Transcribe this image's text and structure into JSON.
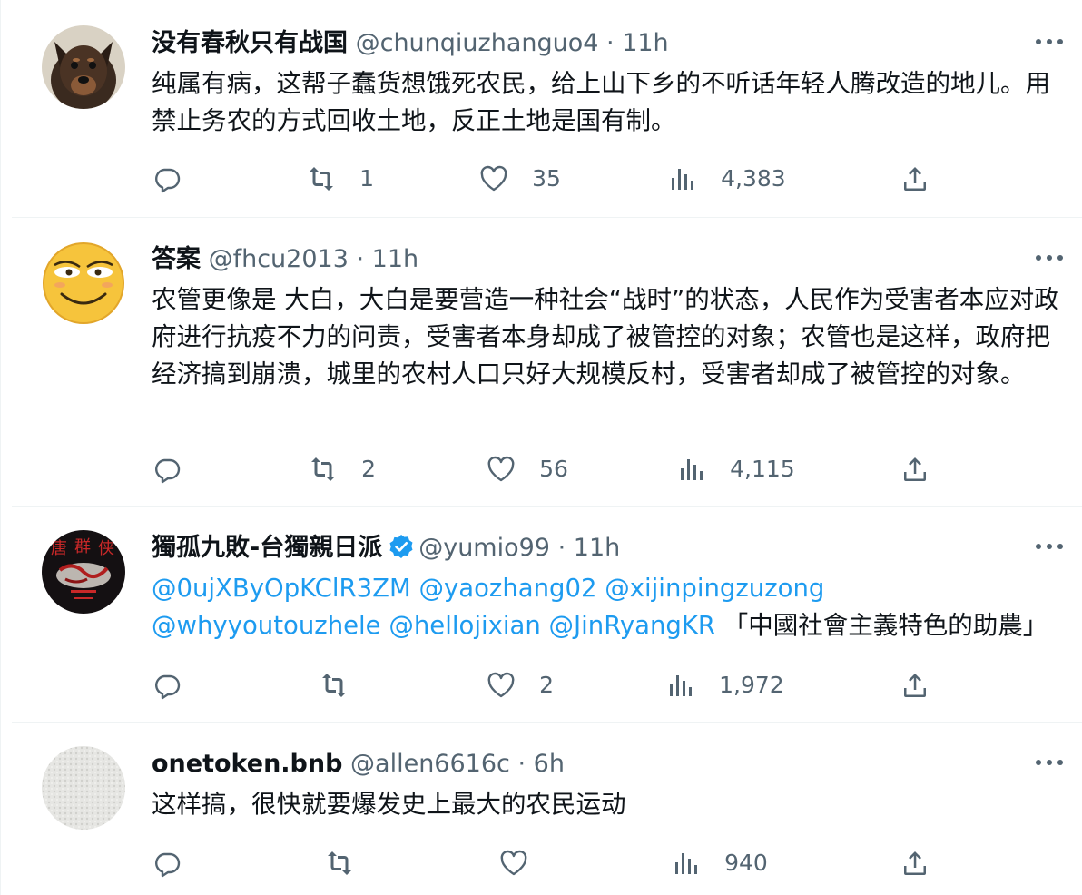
{
  "colors": {
    "text": "#0f1419",
    "secondary": "#536471",
    "link": "#1d9bf0",
    "divider": "#eff3f4"
  },
  "tweets": [
    {
      "display_name": "没有春秋只有战国",
      "handle": "@chunqiuzhanguo4",
      "separator": "·",
      "time": "11h",
      "text": "纯属有病，这帮子蠢货想饿死农民，给上山下乡的不听话年轻人腾改造的地儿。用禁止务农的方式回收土地，反正土地是国有制。",
      "replies": "",
      "retweets": "1",
      "likes": "35",
      "views": "4,383",
      "avatar_icon": "dog-avatar"
    },
    {
      "display_name": "答案",
      "handle": "@fhcu2013",
      "separator": "·",
      "time": "11h",
      "text": "农管更像是 大白，大白是要营造一种社会“战时”的状态，人民作为受害者本应对政府进行抗疫不力的问责，受害者本身却成了被管控的对象；农管也是这样，政府把经济搞到崩溃，城里的农村人口只好大规模反村，受害者却成了被管控的对象。",
      "replies": "",
      "retweets": "2",
      "likes": "56",
      "views": "4,115",
      "avatar_icon": "smiley-avatar"
    },
    {
      "display_name": "獨孤九敗-台獨親日派",
      "verified_icon": "verified-badge-icon",
      "handle": "@yumio99",
      "separator": "·",
      "time": "11h",
      "mentions": [
        "@0ujXByOpKClR3ZM",
        "@yaozhang02",
        "@xijinpingzuzong",
        "@whyyoutouzhele",
        "@hellojixian",
        "@JinRyangKR"
      ],
      "text": "「中國社會主義特色的助農」",
      "replies": "",
      "retweets": "",
      "likes": "2",
      "views": "1,972",
      "avatar_icon": "dark-artwork-avatar"
    },
    {
      "display_name": "onetoken.bnb",
      "handle": "@allen6616c",
      "separator": "·",
      "time": "6h",
      "text": "这样搞，很快就要爆发史上最大的农民运动",
      "replies": "",
      "retweets": "",
      "likes": "",
      "views": "940",
      "avatar_icon": "white-texture-avatar"
    }
  ]
}
